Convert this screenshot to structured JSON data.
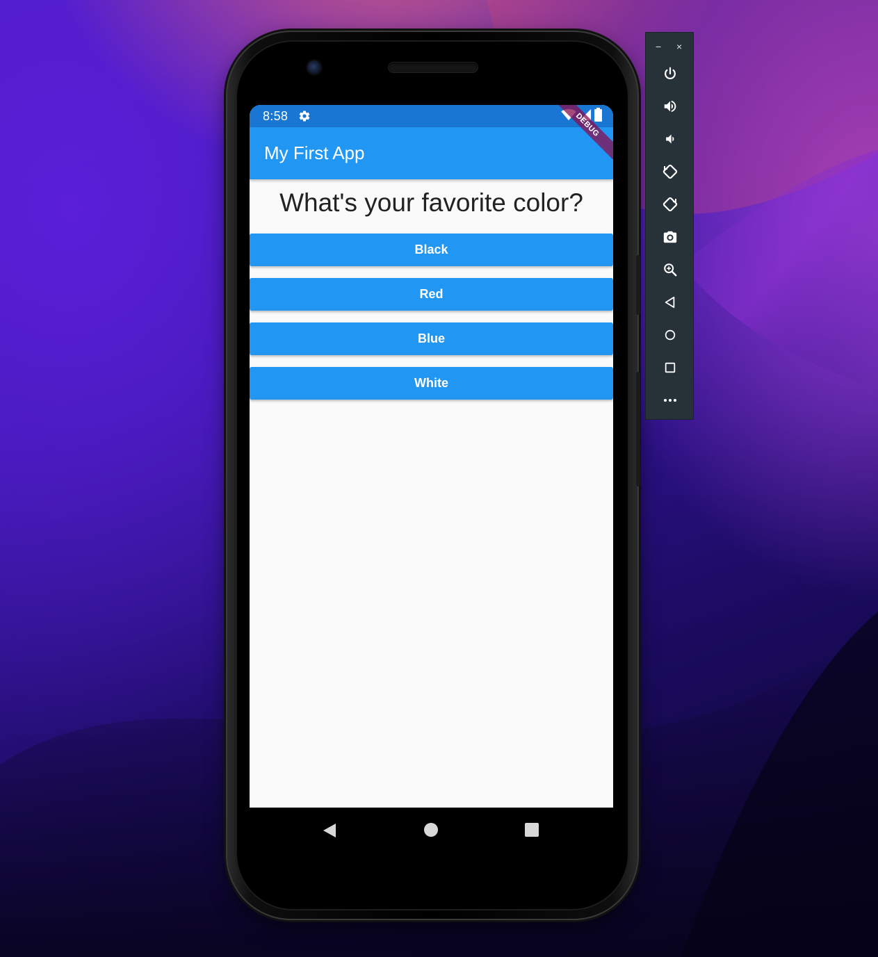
{
  "status_bar": {
    "time": "8:58"
  },
  "app_bar": {
    "title": "My First App",
    "debug_banner": "DEBUG"
  },
  "main": {
    "question": "What's your favorite color?",
    "answers": [
      "Black",
      "Red",
      "Blue",
      "White"
    ]
  },
  "emulator_toolbar": {
    "minimize": "−",
    "close": "×",
    "buttons": [
      "power-icon",
      "volume-up-icon",
      "volume-down-icon",
      "rotate-left-icon",
      "rotate-right-icon",
      "camera-icon",
      "zoom-icon",
      "back-icon",
      "home-icon",
      "overview-icon",
      "more-icon"
    ]
  },
  "colors": {
    "app_bar": "#2196f3",
    "status_bar": "#1976d2",
    "button": "#2196f3",
    "screen_bg": "#fafafa",
    "toolbar_bg": "#263238"
  }
}
